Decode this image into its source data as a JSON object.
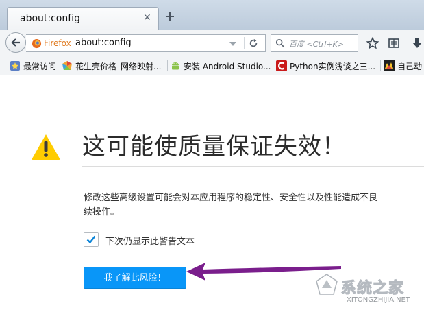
{
  "tab": {
    "title": "about:config",
    "close": "✕"
  },
  "navbar": {
    "identity_label": "Firefox",
    "url": "about:config",
    "search_placeholder": "百度 <Ctrl+K>"
  },
  "bookmarks": [
    {
      "label": "最常访问",
      "icon": "bookmark-star-icon"
    },
    {
      "label": "花生壳价格_网络映射...",
      "icon": "peanut-shell-icon"
    },
    {
      "label": "安装 Android Studio...",
      "icon": "android-icon"
    },
    {
      "label": "Python实例浅谈之三...",
      "icon": "csdn-icon"
    },
    {
      "label": "自己动",
      "icon": "game-icon"
    }
  ],
  "content": {
    "title": "这可能使质量保证失效！",
    "description_line1": "修改这些高级设置可能会对本应用程序的稳定性、安全性以及性能造成不良",
    "description_line2": "续操作。",
    "checkbox_label": "下次仍显示此警告文本",
    "checkbox_checked": true,
    "accept_button": "我了解此风险！"
  },
  "watermark": {
    "text": "系统之家",
    "url": "XITONGZHIJIA.NET"
  },
  "colors": {
    "accent": "#0996f8",
    "warning": "#ffcc00",
    "annotation_arrow": "#7a1e8c"
  }
}
